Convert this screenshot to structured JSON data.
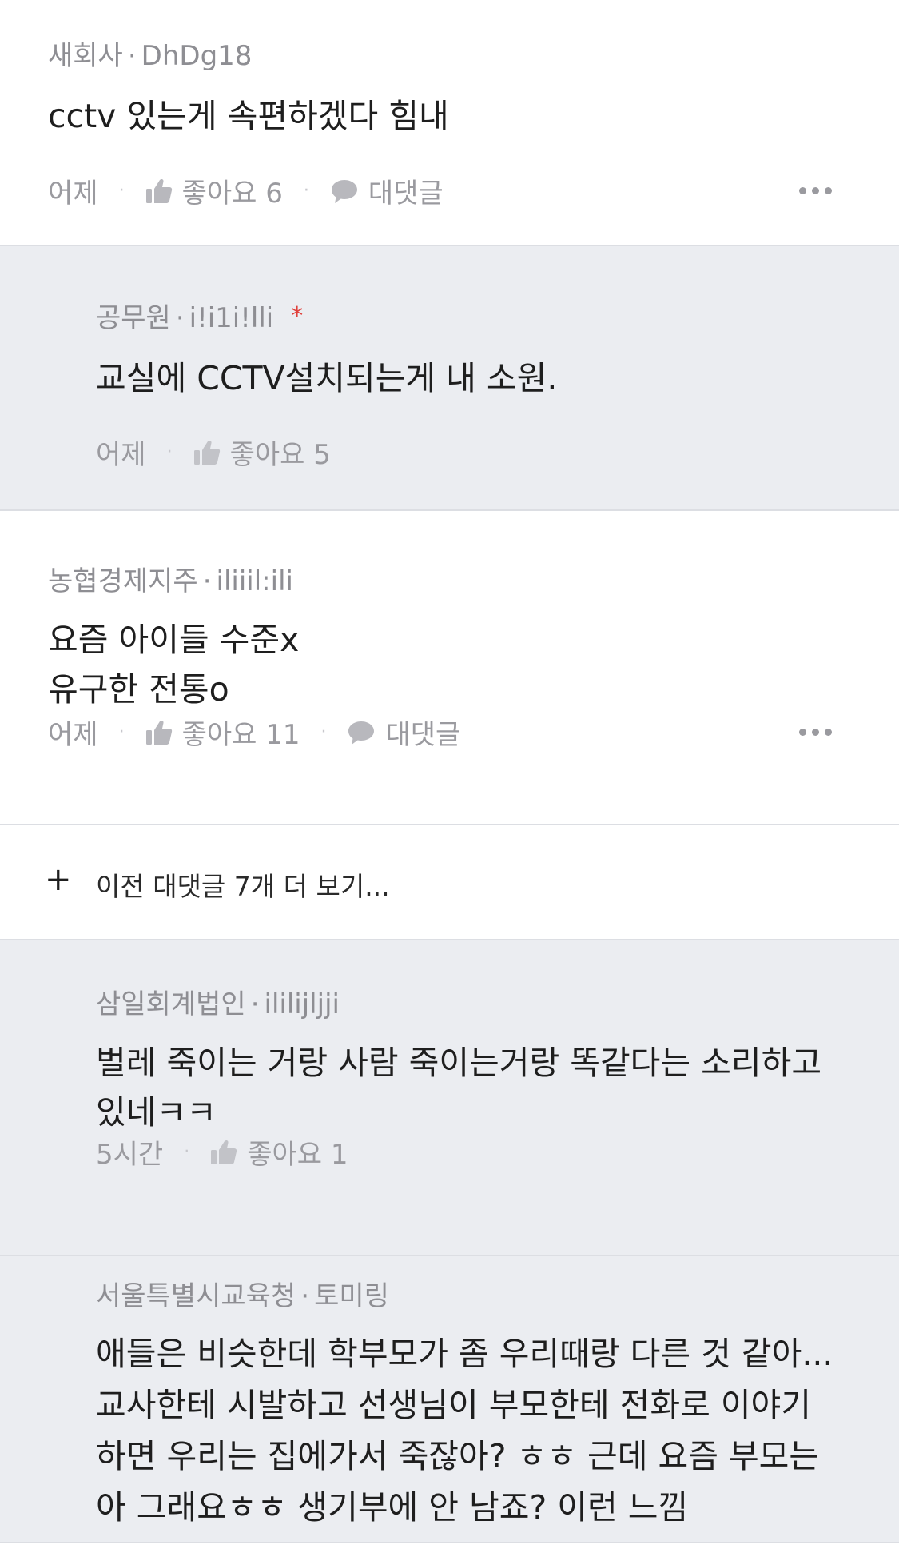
{
  "comments": [
    {
      "org": "새회사",
      "user": "DhDg18",
      "text": [
        "cctv 있는게 속편하겠다 힘내"
      ],
      "time": "어제",
      "like_label": "좋아요 6",
      "reply_label": "대댓글"
    },
    {
      "org": "공무원",
      "user": "i!i1i!lli",
      "badge": "*",
      "text": [
        "교실에 CCTV설치되는게 내 소원."
      ],
      "time": "어제",
      "like_label": "좋아요 5"
    },
    {
      "org": "농협경제지주",
      "user": "iliiil:ili",
      "text": [
        "요즘 아이들 수준x",
        "유구한 전통o"
      ],
      "time": "어제",
      "like_label": "좋아요 11",
      "reply_label": "대댓글"
    },
    {
      "org": "삼일회계법인",
      "user": "ililijljji",
      "text": [
        "벌레 죽이는 거랑 사람 죽이는거랑 똑같다는 소리하고",
        "있네ㅋㅋ"
      ],
      "time": "5시간",
      "like_label": "좋아요 1"
    },
    {
      "org": "서울특별시교육청",
      "user": "토미링",
      "text": [
        "애들은 비슷한데 학부모가 좀 우리때랑 다른 것 같아...",
        "교사한테 시발하고 선생님이 부모한테 전화로 이야기",
        "하면 우리는 집에가서 죽잖아? ㅎㅎ 근데 요즘 부모는",
        "아 그래요ㅎㅎ 생기부에 안 남죠? 이런 느낌"
      ]
    }
  ],
  "load_more": {
    "icon": "plus-icon",
    "label": "이전 대댓글 7개 더 보기..."
  },
  "separator": "·"
}
